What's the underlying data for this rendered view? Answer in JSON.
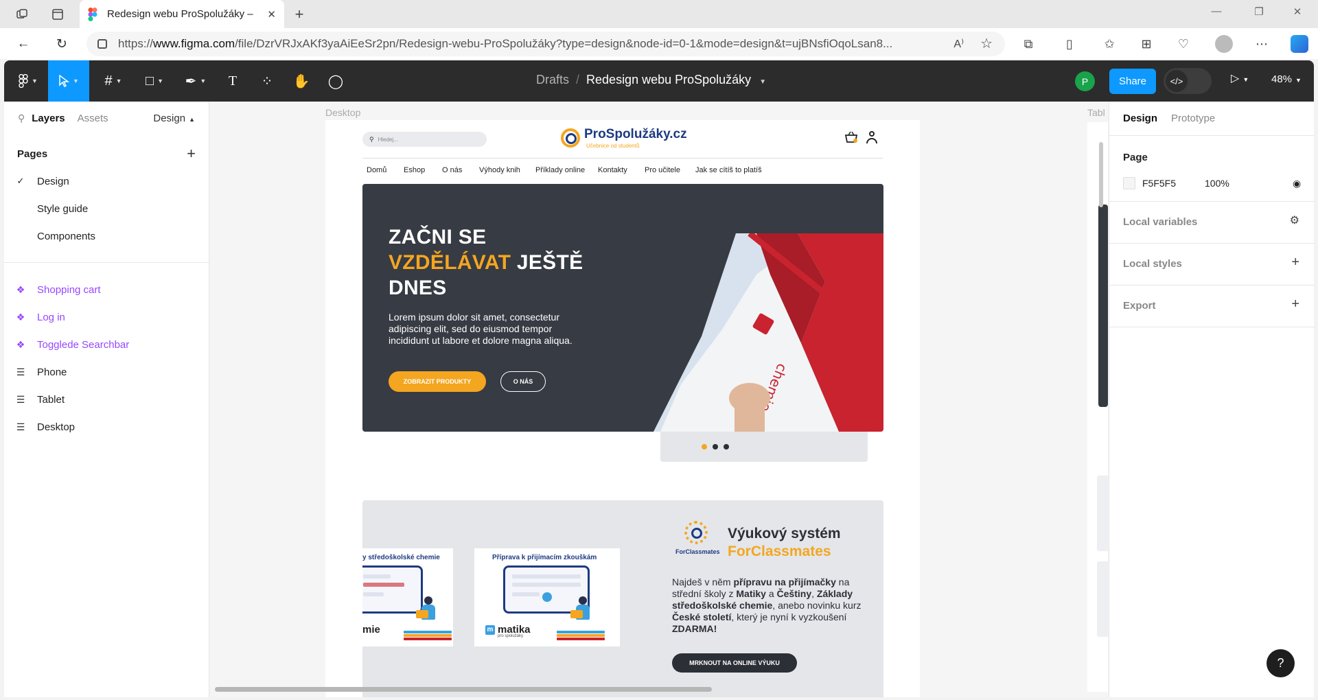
{
  "browser": {
    "tab_title": "Redesign webu ProSpolužáky – F",
    "url_prefix": "https://",
    "url_host": "www.figma.com",
    "url_path": "/file/DzrVRJxAKf3yaAiEeSr2pn/Redesign-webu-ProSpolužáky?type=design&node-id=0-1&mode=design&t=ujBNsfiOqoLsan8..."
  },
  "toolbar": {
    "breadcrumb_parent": "Drafts",
    "breadcrumb_sep": "/",
    "file_name": "Redesign webu ProSpolužáky",
    "user_initial": "P",
    "share_label": "Share",
    "zoom": "48%"
  },
  "left_panel": {
    "tab_layers": "Layers",
    "tab_assets": "Assets",
    "tab_design": "Design",
    "pages_title": "Pages",
    "pages": [
      "Design",
      "Style guide",
      "Components"
    ],
    "selected_page": "Design",
    "layers": [
      {
        "label": "Shopping cart",
        "kind": "component"
      },
      {
        "label": "Log in",
        "kind": "component"
      },
      {
        "label": "Togglede Searchbar",
        "kind": "component"
      },
      {
        "label": "Phone",
        "kind": "frame"
      },
      {
        "label": "Tablet",
        "kind": "frame"
      },
      {
        "label": "Desktop",
        "kind": "frame"
      }
    ]
  },
  "canvas": {
    "frame_desktop_label": "Desktop",
    "frame_tablet_label": "Tabl",
    "site": {
      "search_placeholder": "Hledej...",
      "logo_name": "ProSpolužáky.cz",
      "logo_sub": "Učebnice od studentů",
      "nav": [
        "Domů",
        "Eshop",
        "O nás",
        "Výhody knih",
        "Příklady online",
        "Kontakty",
        "Pro učitele",
        "Jak se cítíš to platíš"
      ],
      "hero_title_1": "ZAČNI SE",
      "hero_title_accent": "VZDĚLÁVAT",
      "hero_title_2": " JEŠTĚ",
      "hero_title_3": "DNES",
      "hero_text": "Lorem ipsum dolor sit amet, consectetur adipiscing elit, sed do eiusmod tempor incididunt ut labore et dolore magna aliqua.",
      "hero_btn_primary": "ZOBRAZIT PRODUKTY",
      "hero_btn_secondary": "O NÁS",
      "slider_active_index": 0,
      "course1_title": "y středoškolské chemie",
      "course1_brand": "mie",
      "course2_title": "Příprava k přijímacím zkouškám",
      "course2_brand": "matika",
      "course2_brand_sub": "pro spolužáky",
      "fc_logo_label": "ForClassmates",
      "fc_title_1": "Výukový systém",
      "fc_title_2": "ForClassmates",
      "fc_text_html_parts": [
        "Najdeš v něm ",
        "přípravu na přijímačky",
        " na střední školy z ",
        "Matiky",
        " a ",
        "Češtiny",
        ", ",
        "Základy středoškolské chemie",
        ", anebo novinku kurz ",
        "České století",
        ", který je nyní k vyzkoušení ",
        "ZDARMA!"
      ],
      "fc_btn": "MRKNOUT NA ONLINE VÝUKU"
    }
  },
  "right_panel": {
    "tab_design": "Design",
    "tab_prototype": "Prototype",
    "page_label": "Page",
    "page_fill_hex": "F5F5F5",
    "page_fill_opacity": "100%",
    "local_variables": "Local variables",
    "local_styles": "Local styles",
    "export": "Export"
  },
  "colors": {
    "figma_blue": "#0d99ff",
    "component_purple": "#9747ff",
    "brand_orange": "#f4a620",
    "brand_navy": "#1d3a82",
    "hero_dark": "#373b43"
  }
}
